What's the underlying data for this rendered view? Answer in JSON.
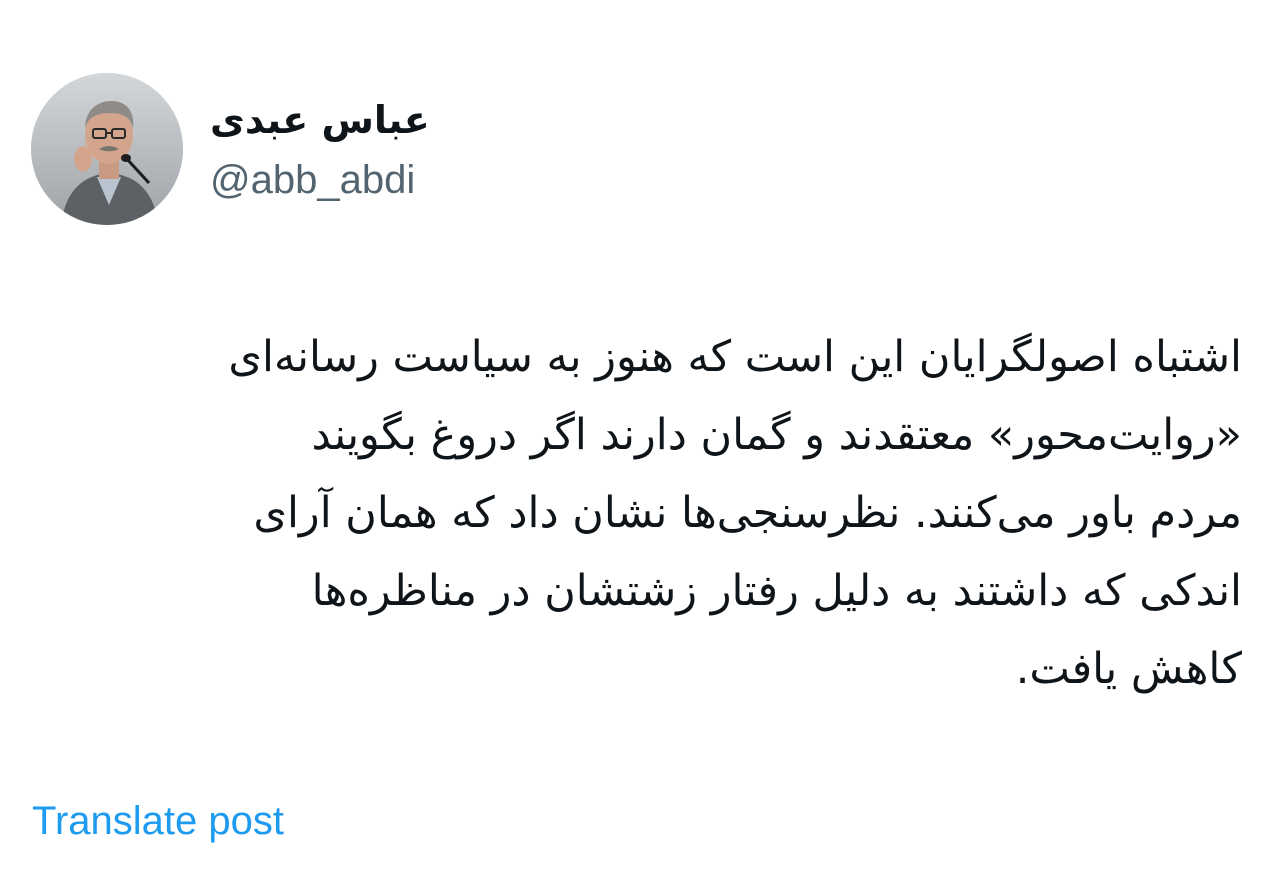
{
  "post": {
    "author": {
      "display_name": "عباس عبدی",
      "handle": "@abb_abdi",
      "avatar_icon": "profile-photo"
    },
    "text_lines": [
      "اشتباه اصولگرایان این است که هنوز به سیاست رسانه‌ای",
      "«روایت‌محور» معتقدند و گمان دارند اگر دروغ بگویند",
      "مردم باور می‌کنند. نظرسنجی‌ها نشان داد که همان آرای",
      "اندکی که داشتند به دلیل رفتار زشتشان در مناظره‌ها",
      "کاهش یافت."
    ],
    "translate_label": "Translate post"
  },
  "colors": {
    "text": "#0f1419",
    "secondary": "#536471",
    "link": "#1d9bf0",
    "background": "#ffffff"
  }
}
